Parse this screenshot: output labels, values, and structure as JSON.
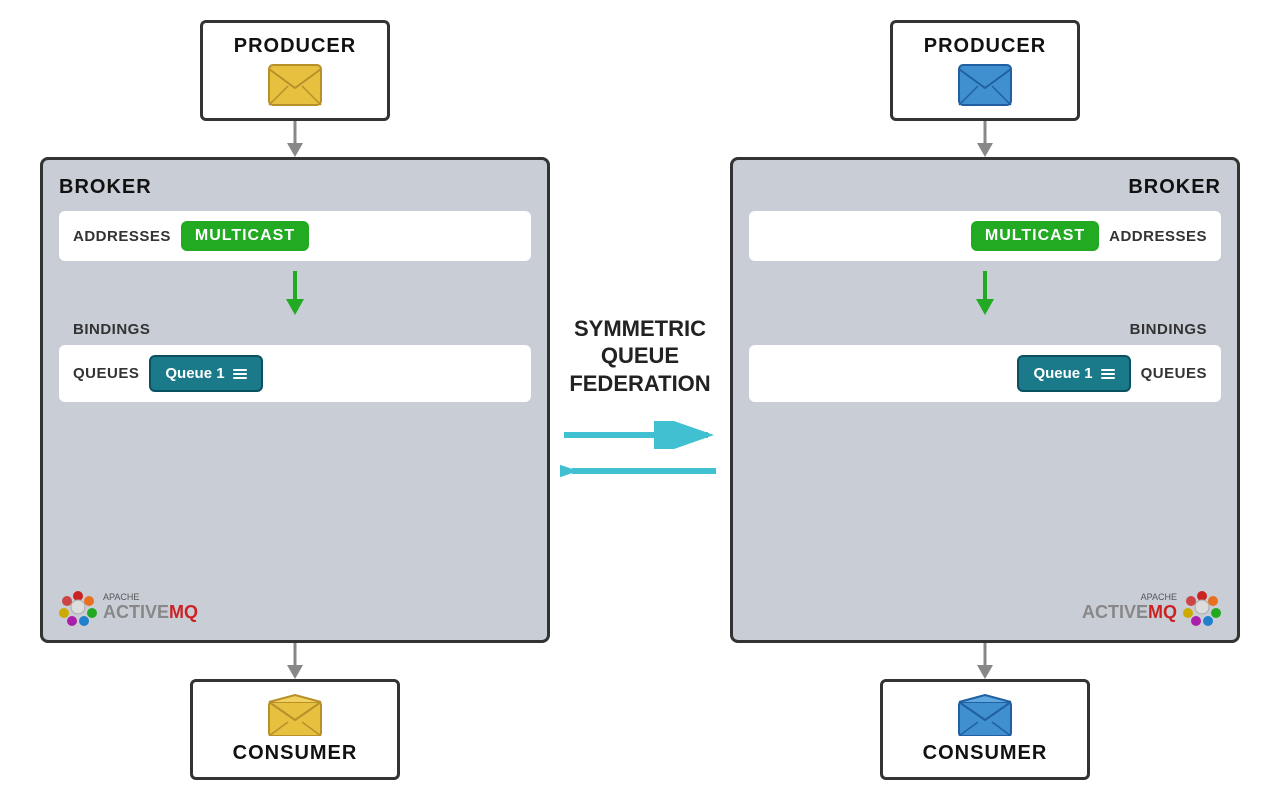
{
  "left": {
    "producer": {
      "label": "PRODUCER",
      "envelope_color": "#e8c040"
    },
    "broker": {
      "label": "BROKER",
      "addresses_label": "ADDRESSES",
      "multicast_label": "MULTICAST",
      "bindings_label": "BINDINGS",
      "queues_label": "QUEUES",
      "queue_name": "Queue 1"
    },
    "consumer": {
      "label": "CONSUMER",
      "envelope_color": "#e8c040"
    }
  },
  "right": {
    "producer": {
      "label": "PRODUCER",
      "envelope_color": "#4090d0"
    },
    "broker": {
      "label": "BROKER",
      "addresses_label": "ADDRESSES",
      "multicast_label": "MULTICAST",
      "bindings_label": "BINDINGS",
      "queues_label": "QUEUES",
      "queue_name": "Queue 1"
    },
    "consumer": {
      "label": "CONSUMER",
      "envelope_color": "#4090d0"
    }
  },
  "center": {
    "line1": "SYMMETRIC",
    "line2": "QUEUE",
    "line3": "FEDERATION"
  },
  "activemq": {
    "apache_text": "APACHE",
    "active_text": "ACTIVE",
    "mq_text": "MQ"
  }
}
